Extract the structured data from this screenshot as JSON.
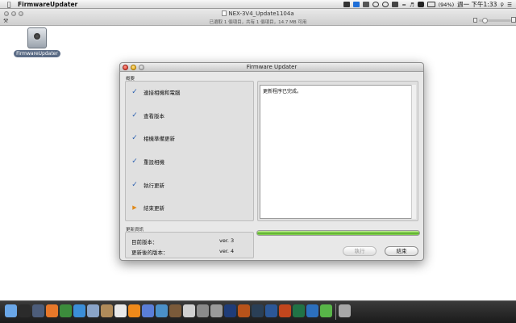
{
  "menubar": {
    "app_name": "FirmwareUpdater",
    "battery": "(94%)",
    "clock": "週一 下午1:33"
  },
  "finder": {
    "title": "NEX-3V4_Update1104a",
    "status": "已選取 1 個項目，共有 1 個項目，14.7 MB 可用"
  },
  "desktop": {
    "icon_label": "FirmwareUpdater"
  },
  "dialog": {
    "title": "Firmware Updater",
    "steps_group_label": "概要",
    "steps": [
      {
        "label": "連接相機和電腦",
        "state": "done"
      },
      {
        "label": "查看版本",
        "state": "done"
      },
      {
        "label": "相機準備更新",
        "state": "done"
      },
      {
        "label": "重設相機",
        "state": "done"
      },
      {
        "label": "執行更新",
        "state": "done"
      },
      {
        "label": "結束更新",
        "state": "current"
      }
    ],
    "log_text": "更新程序已完成。",
    "info_group_label": "更新資訊",
    "current_version_label": "目前版本：",
    "current_version_value": "ver. 3",
    "new_version_label": "更新後的版本：",
    "new_version_value": "ver. 4",
    "progress_percent": 100,
    "execute_button": "執行",
    "finish_button": "結束"
  },
  "colors": {
    "check": "#2a5fb0",
    "current_arrow": "#e08a1a",
    "progress": "#6ec43a"
  },
  "dock": {
    "items": [
      "finder-icon",
      "dashboard-icon",
      "mission-control-icon",
      "firefox-icon",
      "chrome-icon",
      "safari-icon",
      "mail-icon",
      "contacts-icon",
      "calendar-icon",
      "vlc-icon",
      "itunes-icon",
      "iphoto-icon",
      "garageband-icon",
      "preview-icon",
      "utilities-icon",
      "system-preferences-icon",
      "photoshop-icon",
      "illustrator-icon",
      "lightroom-icon",
      "word-icon",
      "powerpoint-icon",
      "excel-icon",
      "outlook-icon",
      "messages-icon",
      "trash-icon"
    ]
  }
}
